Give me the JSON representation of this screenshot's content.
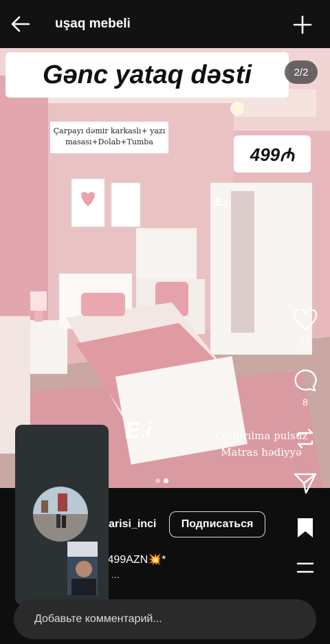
{
  "header": {
    "title": "uşaq mebeli",
    "back_icon": "arrow-left-icon",
    "add_icon": "plus-icon"
  },
  "post": {
    "headline": "Gənc yataq dəsti",
    "counter": "2/2",
    "subnote": "Çarpayı dəmir karkaslı+ yazı masası+Dolab+Tumba",
    "price": "499₼",
    "brand_small": "E.i",
    "brand_big": "E.i",
    "delivery_line1": "Çatdırılma pulsuz",
    "delivery_line2": "Matras hədiyyə",
    "dots": 2,
    "active_dot": 2
  },
  "actions": {
    "likes": "27",
    "comments": "8"
  },
  "author": {
    "username": "arisi_inci",
    "subscribe_label": "Подписаться"
  },
  "caption": {
    "line1": "ti 499AZN💥*",
    "line2": "ar ..."
  },
  "comment": {
    "placeholder": "Добавьте комментарий..."
  }
}
